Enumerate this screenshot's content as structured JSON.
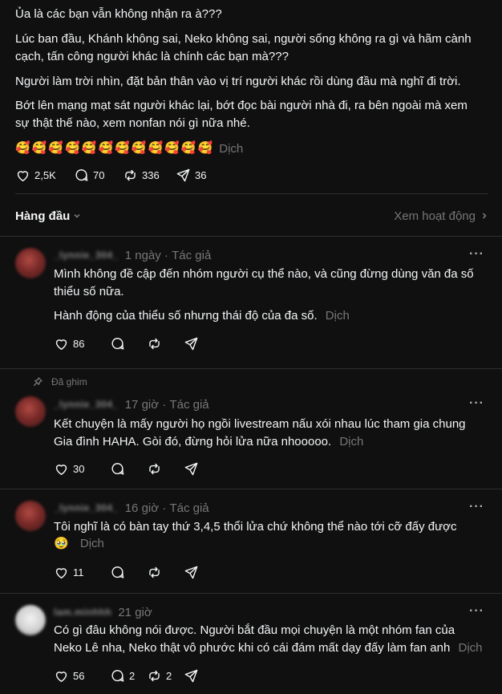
{
  "post": {
    "paragraphs": [
      "Ủa là các bạn vẫn không nhận ra à???",
      "Lúc ban đầu, Khánh không sai, Neko không sai, người sống không ra gì và hãm cành cạch, tấn công người khác là chính các bạn mà???",
      "Người làm trời nhìn, đặt bản thân vào vị trí người khác rồi dùng đầu mà nghĩ đi trời.",
      "Bớt lên mạng mạt sát người khác lại, bớt đọc bài người nhà đi, ra bên ngoài mà xem sự thật thế nào, xem nonfan nói gì nữa nhé."
    ],
    "emojis": [
      "🥰",
      "🥰",
      "🥰",
      "🥰",
      "🥰",
      "🥰",
      "🥰",
      "🥰",
      "🥰",
      "🥰",
      "🥰",
      "🥰"
    ],
    "translate_label": "Dịch",
    "stats": {
      "likes": "2,5K",
      "replies": "70",
      "reposts": "336",
      "shares": "36"
    }
  },
  "sort": {
    "label": "Hàng đầu",
    "activity_label": "Xem hoạt động"
  },
  "comments": [
    {
      "username": "_lynnie_304_",
      "time": "1 ngày",
      "author_tag": "Tác giả",
      "pinned_label": "",
      "paragraphs": [
        "Mình không đề cập đến nhóm người cụ thể nào, và cũng đừng dùng văn đa số thiểu số nữa.",
        "Hành động của thiểu số nhưng thái độ của đa số."
      ],
      "translate_label": "Dịch",
      "likes": "86",
      "replies": "",
      "reposts": ""
    },
    {
      "username": "_lynnie_304_",
      "time": "17 giờ",
      "author_tag": "Tác giả",
      "pinned_label": "Đã ghim",
      "paragraphs": [
        "Kết chuyện là mấy người họ ngồi livestream nấu xói nhau lúc tham gia chung Gia đình HAHA. Gòi đó, đừng hỏi lửa nữa nhooooo."
      ],
      "translate_label": "Dịch",
      "likes": "30",
      "replies": "",
      "reposts": ""
    },
    {
      "username": "_lynnie_304_",
      "time": "16 giờ",
      "author_tag": "Tác giả",
      "pinned_label": "",
      "paragraphs": [
        "Tôi nghĩ là có bàn tay thứ 3,4,5 thổi lửa chứ không thể nào tới cỡ đấy được"
      ],
      "emoji": "🥹",
      "translate_label": "Dịch",
      "likes": "11",
      "replies": "",
      "reposts": ""
    },
    {
      "username": "lam.minhhh",
      "time": "21 giờ",
      "author_tag": "",
      "pinned_label": "",
      "paragraphs": [
        "Có gì đâu không nói được. Người bắt đầu mọi chuyện là một nhóm fan của Neko Lê nha, Neko thật vô phước khi có cái đám mất dạy đấy làm fan anh"
      ],
      "translate_label": "Dịch",
      "likes": "56",
      "replies": "2",
      "reposts": "2"
    }
  ],
  "colors": {
    "background": "#101010",
    "text": "#f3f5f7",
    "muted": "#777777",
    "divider": "#2e2e2e"
  }
}
